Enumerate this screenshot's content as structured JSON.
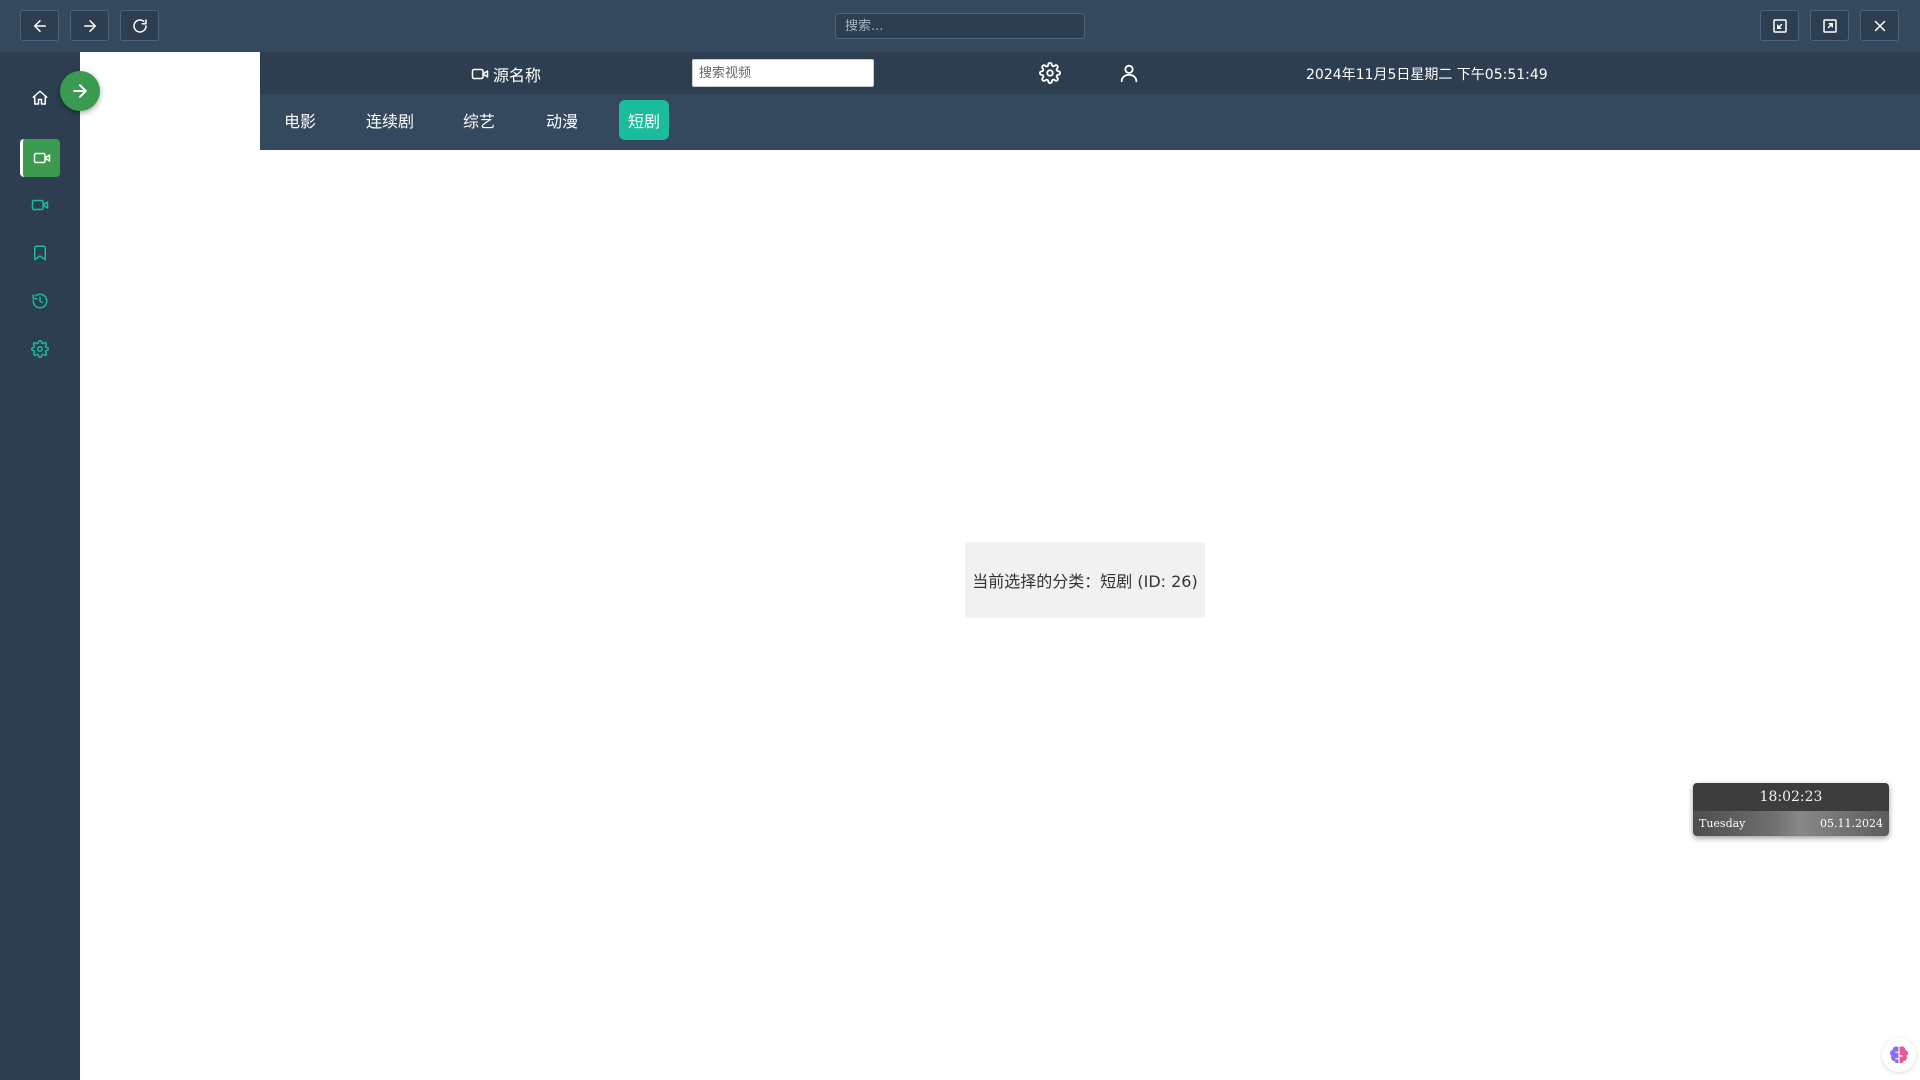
{
  "titlebar": {
    "search_placeholder": "搜索..."
  },
  "header": {
    "source_name": "源名称",
    "video_search_placeholder": "搜索视频",
    "datetime": "2024年11月5日星期二 下午05:51:49"
  },
  "categories": [
    {
      "label": "电影"
    },
    {
      "label": "连续剧"
    },
    {
      "label": "综艺"
    },
    {
      "label": "动漫"
    },
    {
      "label": "短剧",
      "active": true
    }
  ],
  "message": "当前选择的分类：短剧 (ID: 26)",
  "clock": {
    "time": "18:02:23",
    "day": "Tuesday",
    "date": "05.11.2024"
  },
  "colors": {
    "sidebar_bg": "#2c3e50",
    "header_bg": "#2c3e50",
    "catbar_bg": "#34495e",
    "active_category": "#1abc9c",
    "accent_green": "#3c9a4e",
    "sidebar_icon": "#1abc9c"
  },
  "icons": {
    "back": "arrow-left-icon",
    "forward": "arrow-right-icon",
    "reload": "reload-icon",
    "minimize": "minimize-icon",
    "maximize": "maximize-icon",
    "close": "close-icon",
    "home": "home-icon",
    "video": "video-icon",
    "bookmark": "bookmark-icon",
    "history": "history-icon",
    "settings": "gear-icon",
    "user": "user-icon",
    "brain": "brain-icon"
  }
}
